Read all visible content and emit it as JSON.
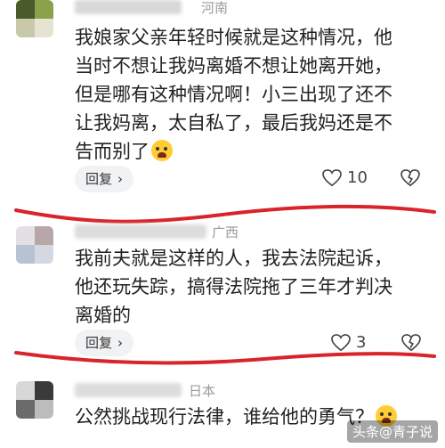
{
  "comments": [
    {
      "region": "河南",
      "lines": [
        "我娘家父亲年轻时候就是这种情况，他",
        "当时不想让我妈离婚不想让她离开她，",
        "但是哪有这种情况啊！小三出现了还不",
        "让我妈离，太自私了，最后我妈还是不",
        "告而别了"
      ],
      "reply_label": "回复",
      "like_count": "10"
    },
    {
      "region": "广西",
      "lines": [
        "我前夫就是这样的人，我去法院起诉，",
        "他还玩失踪，搞得法院拖了三年才判决",
        "离婚的"
      ],
      "reply_label": "回复",
      "like_count": "3"
    },
    {
      "region": "日本",
      "lines": [
        "公然挑战现行法律，谁给他的勇气？"
      ]
    }
  ],
  "icons": {
    "like": "heart-icon",
    "dislike": "broken-heart-icon",
    "reply_chevron": "chevron-right-icon",
    "emoji_1": "crying-face-emoji-icon",
    "emoji_2": "laughing-tears-emoji-icon"
  },
  "watermark": "头条@青子说",
  "colors": {
    "annotation_red": "#d8242a",
    "reply_bg": "#f1f2f4"
  }
}
